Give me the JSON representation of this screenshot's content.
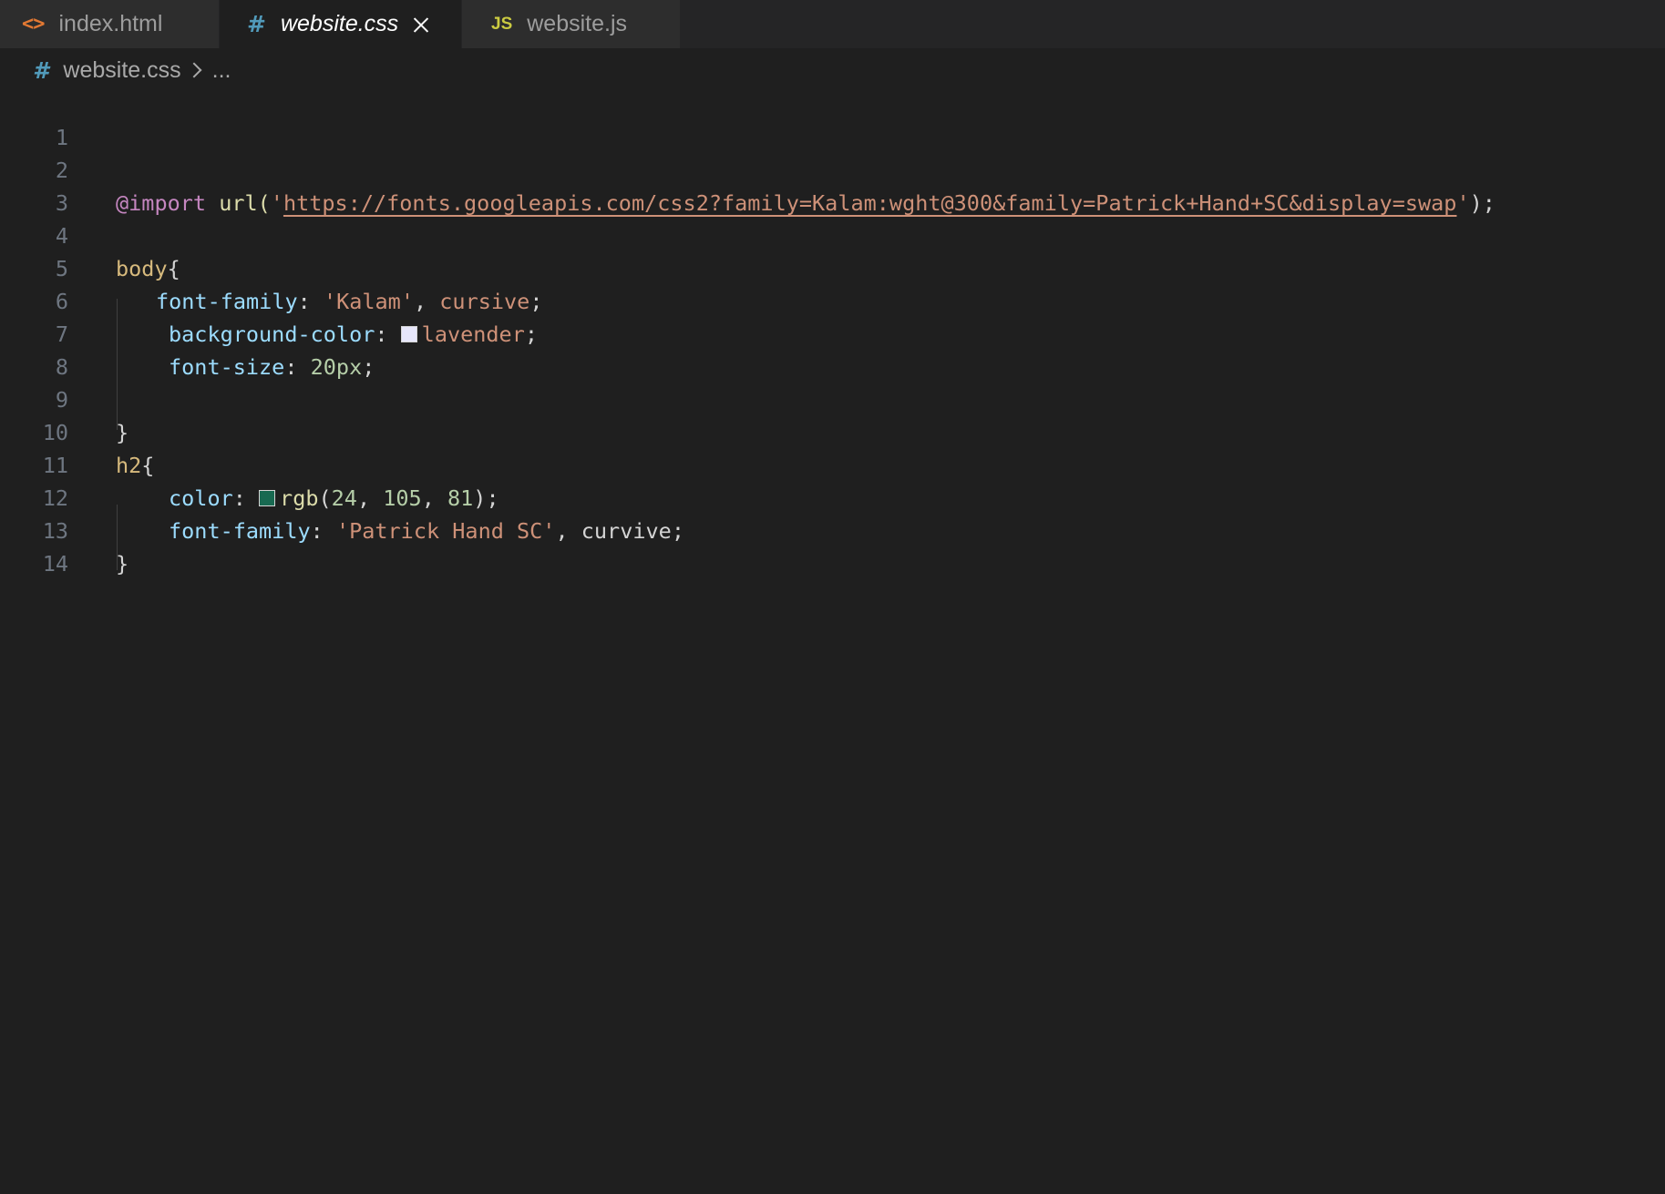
{
  "tabs": [
    {
      "label": "index.html",
      "icon": "html-file-icon",
      "active": false
    },
    {
      "label": "website.css",
      "icon": "css-file-icon",
      "active": true
    },
    {
      "label": "website.js",
      "icon": "js-file-icon",
      "active": false
    }
  ],
  "tab_icon_glyphs": {
    "html": "<>",
    "css": "#",
    "js": "JS"
  },
  "breadcrumb": {
    "file": "website.css",
    "rest": "..."
  },
  "editor": {
    "line_numbers": [
      "1",
      "2",
      "3",
      "4",
      "5",
      "6",
      "7",
      "8",
      "9",
      "10",
      "11",
      "12",
      "13",
      "14"
    ],
    "code": {
      "l2_import": "@import",
      "l2_url_fn": "url(",
      "l2_quote_open": "'",
      "l2_url": "https://fonts.googleapis.com/css2?family=Kalam:wght@300&family=Patrick+Hand+SC&display=swap",
      "l2_quote_close": "'",
      "l2_end": ");",
      "l4_selector": "body",
      "l4_brace": "{",
      "l5_prop": "font-family",
      "l5_colon": ": ",
      "l5_str": "'Kalam'",
      "l5_comma": ", ",
      "l5_val": "cursive",
      "l5_semi": ";",
      "l6_prop": "background-color",
      "l6_colon": ": ",
      "l6_val": "lavender",
      "l6_semi": ";",
      "l7_prop": "font-size",
      "l7_colon": ": ",
      "l7_val": "20px",
      "l7_semi": ";",
      "l9_brace": "}",
      "l10_selector": "h2",
      "l10_brace": "{",
      "l11_prop": "color",
      "l11_colon": ": ",
      "l11_fn": "rgb",
      "l11_open": "(",
      "l11_n1": "24",
      "l11_c1": ", ",
      "l11_n2": "105",
      "l11_c2": ", ",
      "l11_n3": "81",
      "l11_close": ");",
      "l12_prop": "font-family",
      "l12_colon": ": ",
      "l12_str": "'Patrick Hand SC'",
      "l12_comma": ", ",
      "l12_val": "curvive",
      "l12_semi": ";",
      "l13_brace": "}"
    },
    "swatches": {
      "lavender": "#e6e6fa",
      "rgb": "#186951"
    }
  },
  "colors": {
    "editor_bg": "#1f1f1f",
    "tabbar_bg": "#252526",
    "keyword": "#c586c0",
    "string": "#ce9178",
    "selector": "#d7ba7d",
    "property": "#9cdcfe",
    "number": "#b5cea8"
  }
}
